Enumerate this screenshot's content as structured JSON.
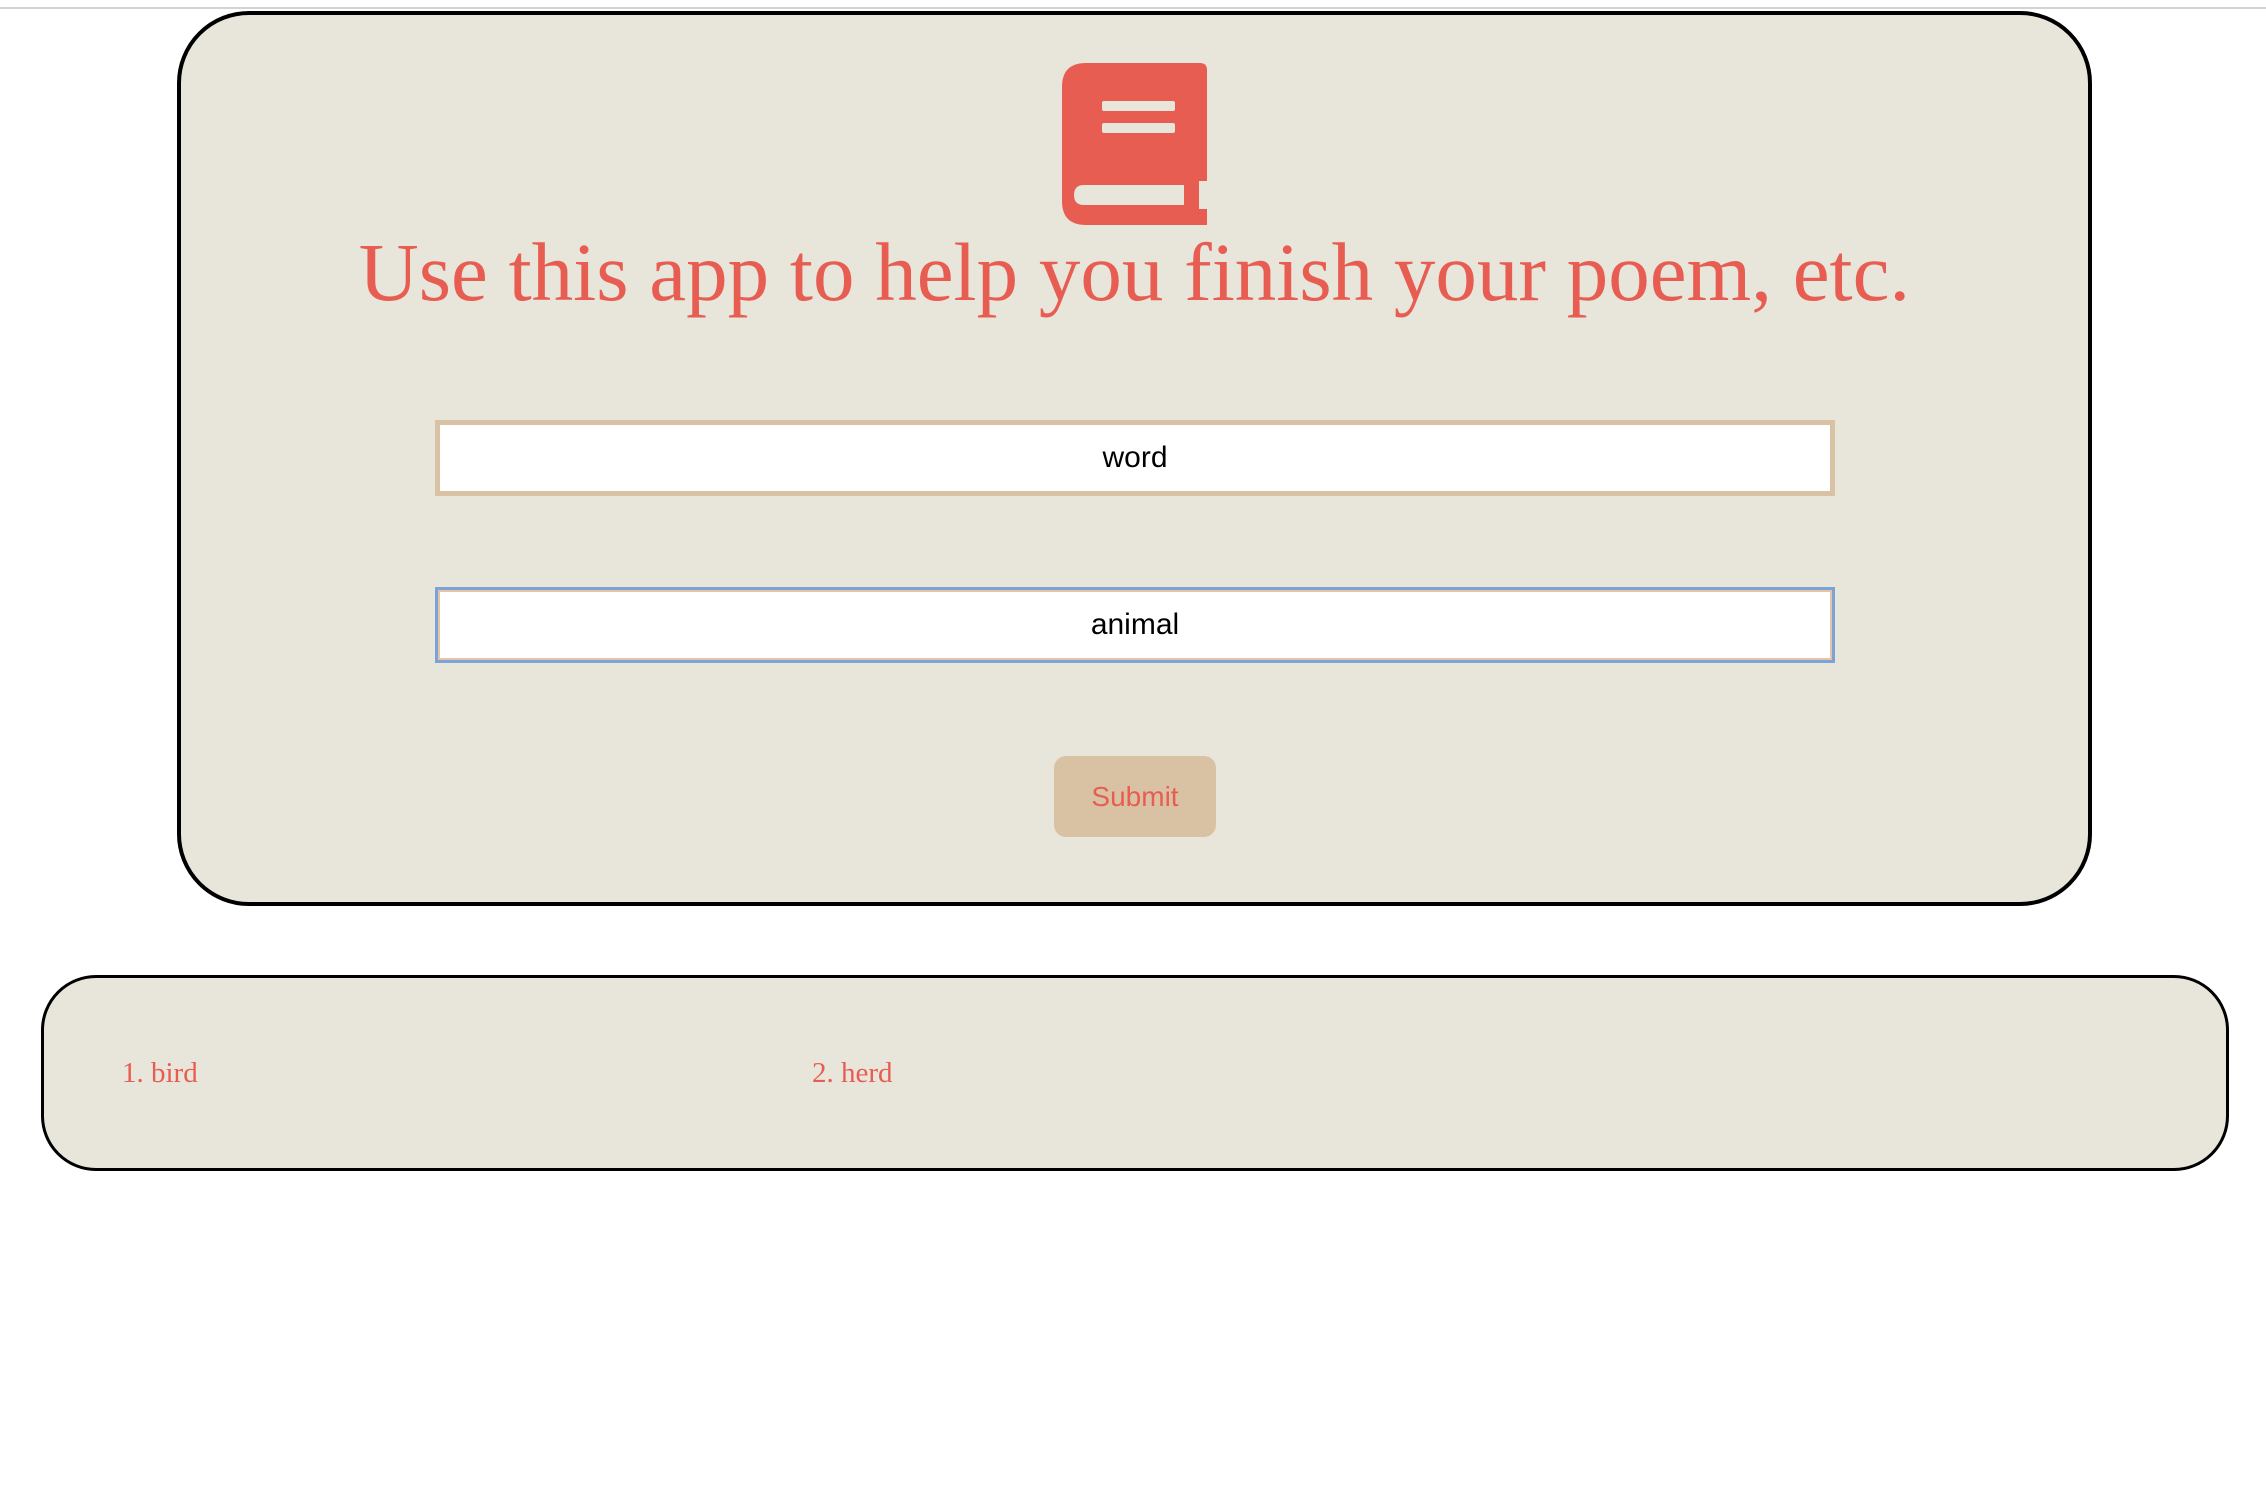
{
  "app": {
    "icon": "book-icon",
    "headline": "Use this app to help you finish your poem, etc."
  },
  "form": {
    "word_field": {
      "value": "word"
    },
    "topic_field": {
      "value": "animal"
    },
    "submit_label": "Submit"
  },
  "results": [
    {
      "label": "1. bird"
    },
    {
      "label": "2. herd"
    }
  ],
  "colors": {
    "accent": "#e85d52",
    "card_background": "#e8e5db",
    "button_background": "#d9c2a4",
    "card_border": "#000000"
  }
}
